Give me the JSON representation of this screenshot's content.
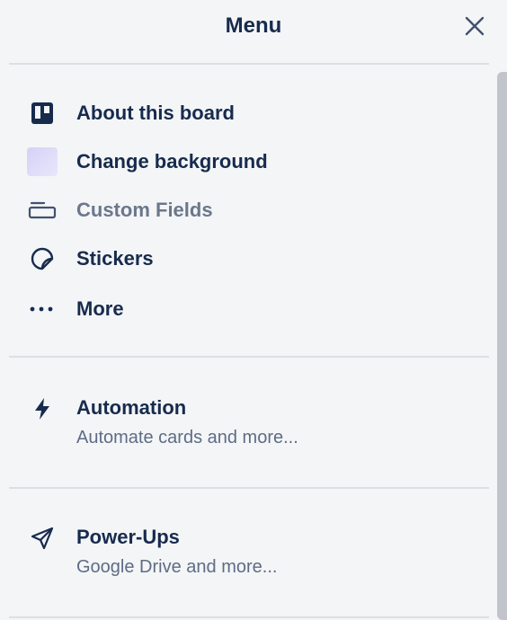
{
  "header": {
    "title": "Menu",
    "close_icon": "close-icon"
  },
  "items": [
    {
      "label": "About this board",
      "icon": "board-icon"
    },
    {
      "label": "Change background",
      "icon": "background-swatch",
      "swatch_from": "#d4d2f6",
      "swatch_to": "#e8e6fb"
    },
    {
      "label": "Custom Fields",
      "icon": "custom-fields-icon",
      "disabled": true
    },
    {
      "label": "Stickers",
      "icon": "sticker-icon"
    },
    {
      "label": "More",
      "icon": "more-icon"
    }
  ],
  "automation": {
    "label": "Automation",
    "description": "Automate cards and more...",
    "icon": "lightning-icon"
  },
  "powerups": {
    "label": "Power-Ups",
    "description": "Google Drive and more...",
    "icon": "rocket-icon"
  },
  "colors": {
    "text": "#172b4d",
    "muted": "#6b778c",
    "subtext": "#5e6c84",
    "background": "#f4f5f7",
    "divider": "#dcdfe4"
  }
}
